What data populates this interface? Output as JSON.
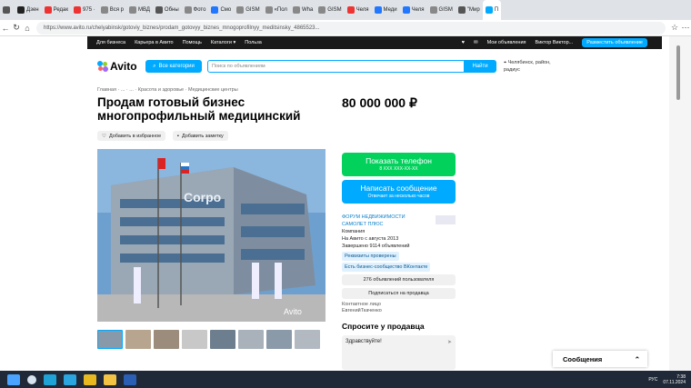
{
  "browser": {
    "tabs": [
      {
        "label": "",
        "color": "#555"
      },
      {
        "label": "Дзен",
        "color": "#222"
      },
      {
        "label": "Редак",
        "color": "#e33"
      },
      {
        "label": "975 ·",
        "color": "#e33"
      },
      {
        "label": "Вся р",
        "color": "#888"
      },
      {
        "label": "МВД",
        "color": "#888"
      },
      {
        "label": "Обны",
        "color": "#555"
      },
      {
        "label": "Фото",
        "color": "#888"
      },
      {
        "label": "Смо",
        "color": "#27f"
      },
      {
        "label": "GISM",
        "color": "#888"
      },
      {
        "label": "«Пол",
        "color": "#888"
      },
      {
        "label": "Wha",
        "color": "#888"
      },
      {
        "label": "GISM",
        "color": "#888"
      },
      {
        "label": "Челя",
        "color": "#e33"
      },
      {
        "label": "Меди",
        "color": "#27f"
      },
      {
        "label": "Челя",
        "color": "#27f"
      },
      {
        "label": "GISM",
        "color": "#888"
      },
      {
        "label": "\"Мир",
        "color": "#555"
      },
      {
        "label": "П",
        "color": "#0af"
      }
    ],
    "url": "https://www.avito.ru/chelyabinsk/gotoviy_biznes/prodam_gotovyy_biznes_mnogoprofilnyy_meditsinsky_4865523..."
  },
  "avito_top": {
    "links": [
      "Для бизнеса",
      "Карьера в Авито",
      "Помощь",
      "Каталоги ▾",
      "Польза"
    ],
    "my_ads": "Мои объявления",
    "user": "Виктор Виктор...",
    "place_ad": "Разместить объявление"
  },
  "header": {
    "logo": "Avito",
    "categories": "Все категории",
    "search_placeholder": "Поиск по объявлениям",
    "find": "Найти",
    "location": "Челябинск, район, радиус"
  },
  "breadcrumbs": "Главная · ... · ... · Красота и здоровье · Медицинские центры",
  "listing": {
    "title": "Продам готовый бизнес многопрофильный медицинский",
    "price": "80 000 000 ₽",
    "fav": "Добавить в избранное",
    "note": "Добавить заметку"
  },
  "actions": {
    "show_phone": "Показать телефон",
    "phone_mask": "8 XXX XXX-XX-XX",
    "write": "Написать сообщение",
    "reply_time": "Отвечает за несколько часов"
  },
  "seller": {
    "name": "ФОРУМ НЕДВИЖИМОСТИ САМОЛЕТ ПЛЮС",
    "type": "Компания",
    "since": "На Авито с августа 2013",
    "done": "Завершено 9114 объявлений",
    "badge1": "Реквизиты проверены",
    "badge2": "Есть бизнес-сообщество ВКонтакте",
    "ads_count": "276 объявлений пользователя",
    "subscribe": "Подписаться на продавца",
    "contact_label": "Контактное лицо",
    "contact_name": "ЕвгенийТкаченко"
  },
  "ask": {
    "title": "Спросите у продавца",
    "message": "Здравствуйте!"
  },
  "notification": "Сообщения",
  "tray": {
    "lang": "РУС",
    "time": "7:38",
    "date": "07.11.2024"
  }
}
